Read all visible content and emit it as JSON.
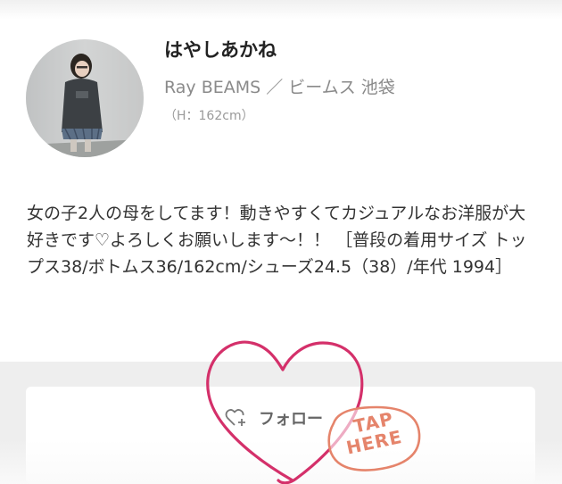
{
  "profile": {
    "name": "はやしあかね",
    "shop": "Ray BEAMS ／ ビームス 池袋",
    "height": "（H：162cm）",
    "avatar_icon": "profile-photo"
  },
  "bio": {
    "text": "女の子2人の母をしてます！動きやすくてカジュアルなお洋服が大好きです♡よろしくお願いします〜！！ ［普段の着用サイズ トップス38/ボトムス36/162cm/シューズ24.5（38）/年代 1994］"
  },
  "follow": {
    "label": "フォロー",
    "icon": "heart-plus-icon"
  },
  "overlay": {
    "tap_word": "TAP",
    "here_word": "HERE",
    "heart_color": "#d4306a",
    "badge_color": "#e5846b"
  },
  "colors": {
    "band": "#eeeeee",
    "name": "#222222",
    "sub": "#8a8a8a"
  }
}
